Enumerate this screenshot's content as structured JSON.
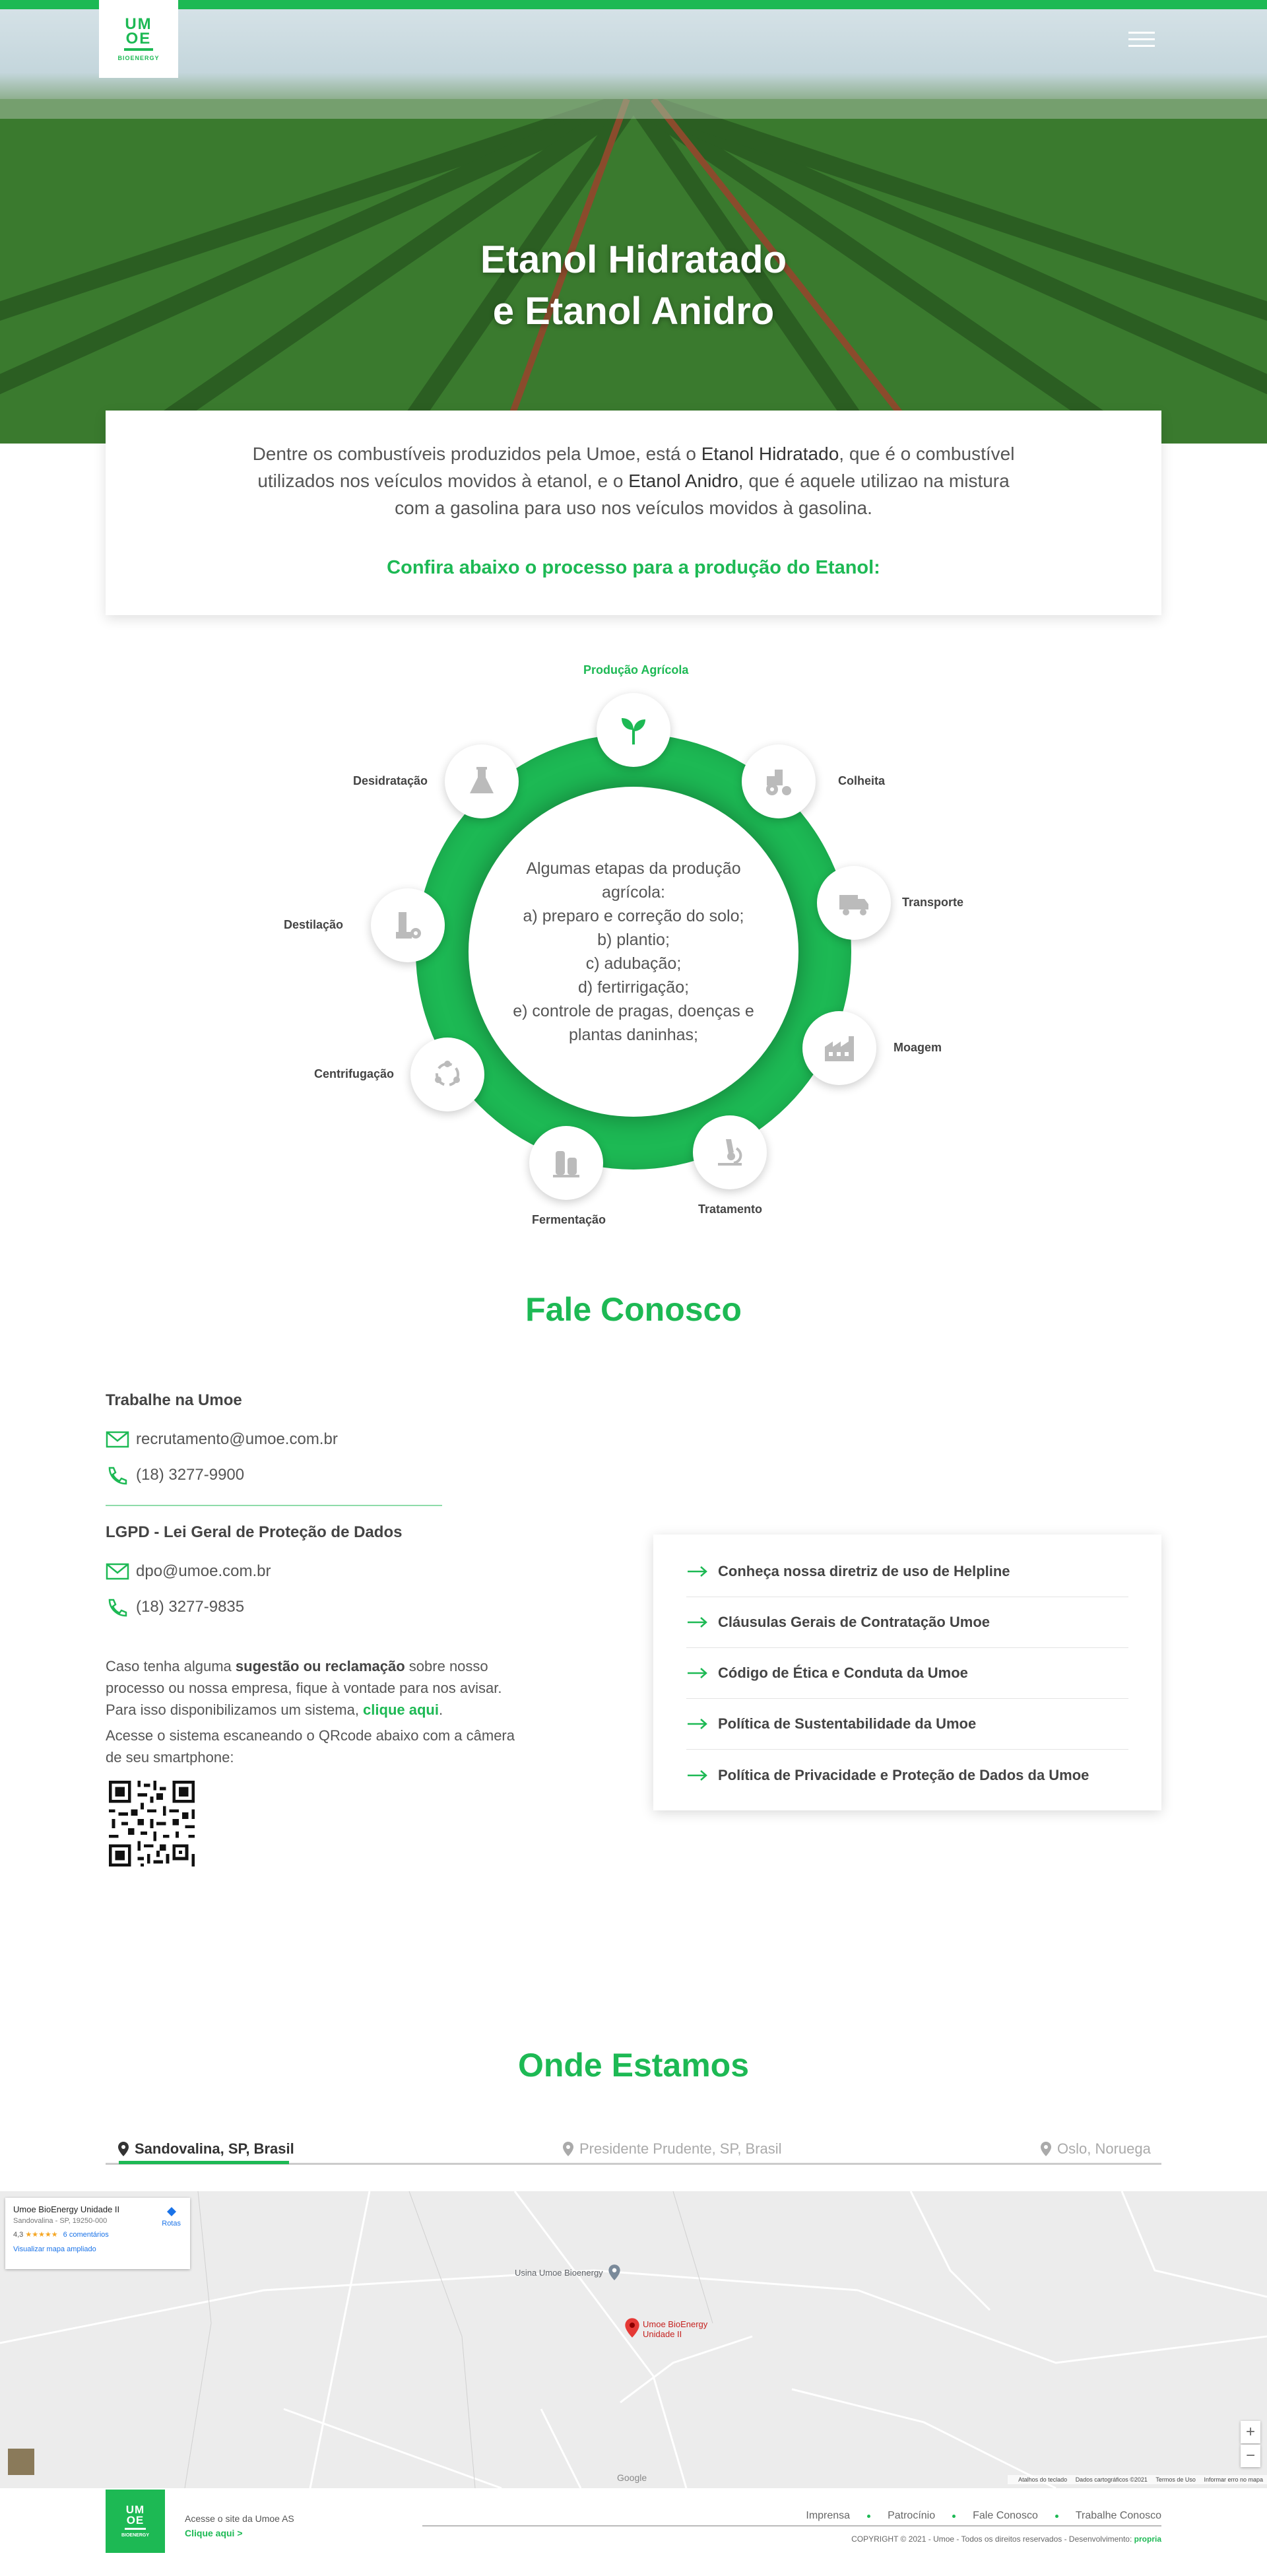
{
  "header": {
    "logo_top": "UM\nOE",
    "logo_sub": "BIOENERGY",
    "title_line1": "Etanol Hidratado",
    "title_line2": "e Etanol Anidro"
  },
  "intro": {
    "text_a": "Dentre os combustíveis produzidos pela Umoe, está o ",
    "term1": "Etanol Hidratado",
    "text_b": ", que é o combustível utilizados nos veículos movidos à etanol, e o ",
    "term2": "Etanol Anidro",
    "text_c": ", que é aquele utilizao na mistura com a gasolina para uso nos veículos movidos à gasolina.",
    "cta": "Confira abaixo o processo para a produção do Etanol:"
  },
  "cycle": {
    "center_title": "Algumas etapas da produção agrícola:",
    "center_items": [
      "a) preparo e correção do solo;",
      "b) plantio;",
      "c) adubação;",
      "d) fertirrigação;",
      "e) controle de pragas, doenças e plantas daninhas;"
    ],
    "steps": [
      {
        "label": "Produção Agrícola",
        "icon": "sprout-icon"
      },
      {
        "label": "Colheita",
        "icon": "tractor-icon"
      },
      {
        "label": "Transporte",
        "icon": "truck-icon"
      },
      {
        "label": "Moagem",
        "icon": "factory-icon"
      },
      {
        "label": "Tratamento",
        "icon": "microscope-icon"
      },
      {
        "label": "Fermentação",
        "icon": "tanks-icon"
      },
      {
        "label": "Centrifugação",
        "icon": "cycle-icon"
      },
      {
        "label": "Destilação",
        "icon": "still-icon"
      },
      {
        "label": "Desidratação",
        "icon": "flask-icon"
      }
    ]
  },
  "contact": {
    "title": "Fale Conosco",
    "work_title": "Trabalhe na Umoe",
    "work_email": "recrutamento@umoe.com.br",
    "work_phone": "(18) 3277-9900",
    "lgpd_title": "LGPD - Lei Geral de Proteção de Dados",
    "lgpd_email": "dpo@umoe.com.br",
    "lgpd_phone": "(18) 3277-9835",
    "para1_a": "Caso tenha alguma ",
    "para1_bold": "sugestão ou reclamação",
    "para1_b": " sobre nosso processo ou nossa empresa, fique à vontade para nos avisar. Para isso disponibilizamos um sistema, ",
    "para1_link": "clique aqui",
    "para1_end": ".",
    "para2": "Acesse o sistema escaneando o QRcode abaixo com a câmera de seu smartphone:",
    "links": [
      "Conheça nossa diretriz de uso de Helpline",
      "Cláusulas Gerais de Contratação Umoe",
      "Código de Ética e Conduta da Umoe",
      "Política de Sustentabilidade da Umoe",
      "Política de Privacidade e Proteção de Dados da Umoe"
    ]
  },
  "location": {
    "title": "Onde Estamos",
    "tabs": [
      "Sandovalina, SP, Brasil",
      "Presidente Prudente, SP, Brasil",
      "Oslo, Noruega"
    ],
    "active_tab": "Sandovalina, SP, Brasil",
    "map": {
      "card_title": "Umoe BioEnergy Unidade II",
      "card_address": "Sandovalina - SP, 19250-000",
      "card_rating": "4,3",
      "card_stars": "★★★★★",
      "card_reviews": "6 comentários",
      "card_link": "Visualizar mapa ampliado",
      "card_directions": "Rotas",
      "place1": "Usina Umoe Bioenergy",
      "pin_label_1": "Umoe BioEnergy",
      "pin_label_2": "Unidade II",
      "google": "Google",
      "zoom_in": "+",
      "zoom_out": "−",
      "attrib": [
        "Atalhos do teclado",
        "Dados cartográficos ©2021",
        "Termos de Uso",
        "Informar erro no mapa"
      ]
    }
  },
  "footer": {
    "logo_top": "UM\nOE",
    "logo_sub": "BIOENERGY",
    "site_text": "Acesse o site da Umoe AS",
    "site_link": "Clique aqui >",
    "nav": [
      "Imprensa",
      "Patrocínio",
      "Fale Conosco",
      "Trabalhe Conosco"
    ],
    "copyright": "COPYRIGHT © 2021 - Umoe - Todos os direitos reservados - Desenvolvimento:",
    "dev": "propria"
  },
  "colors": {
    "brand": "#1db954"
  }
}
